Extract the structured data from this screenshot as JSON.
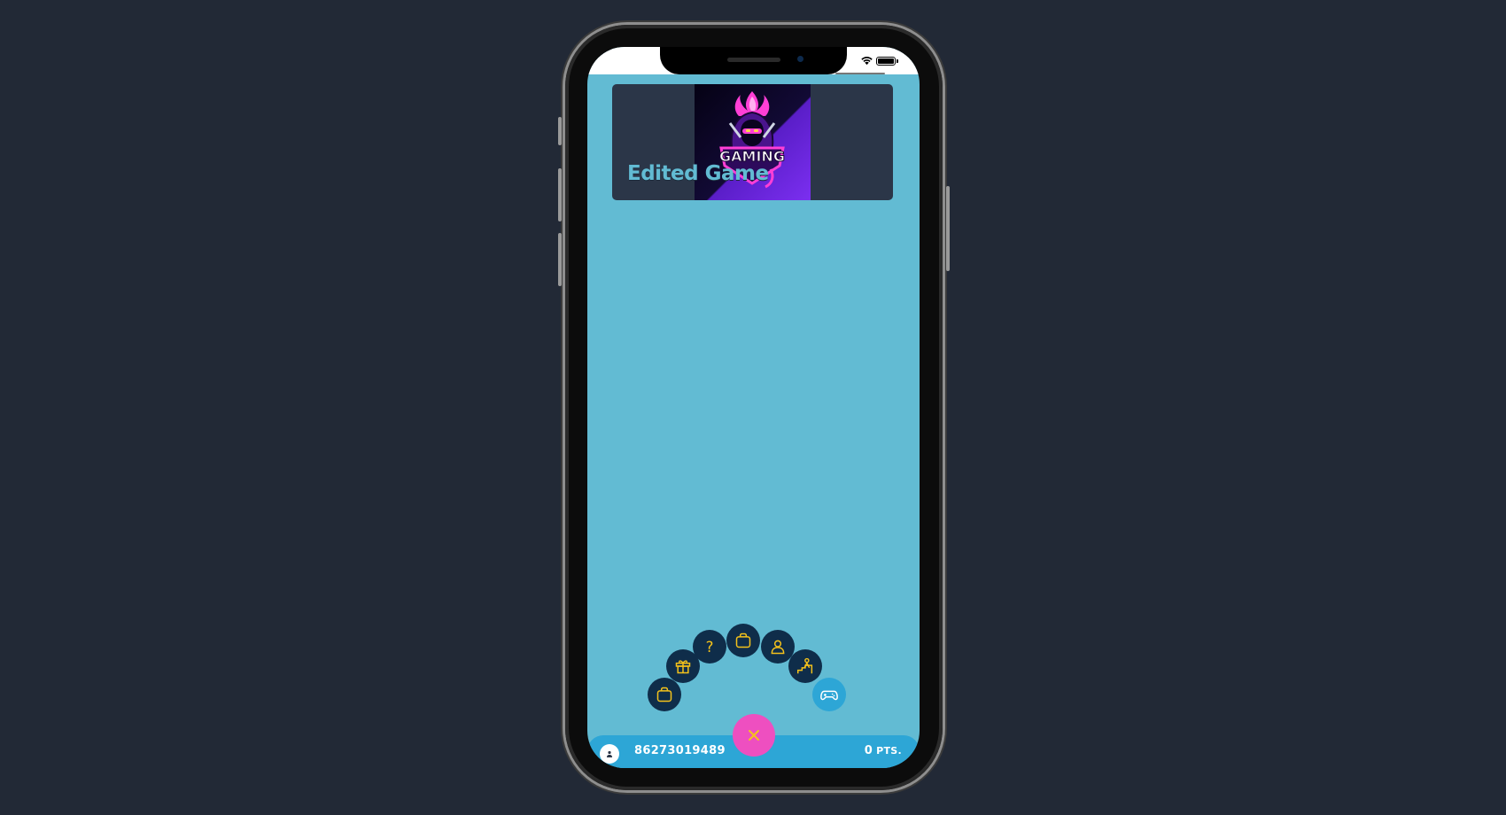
{
  "game_card": {
    "title": "Edited Game",
    "logo": {
      "text": "GAMING",
      "icon": "hooded-ninja-gaming-logo"
    }
  },
  "fab_menu": {
    "items": [
      {
        "name": "bag",
        "icon": "shopping-bag-icon"
      },
      {
        "name": "gift",
        "icon": "gift-icon"
      },
      {
        "name": "help",
        "icon": "question-icon"
      },
      {
        "name": "shop",
        "icon": "shopping-bag-icon"
      },
      {
        "name": "profile",
        "icon": "user-icon"
      },
      {
        "name": "leaderboard",
        "icon": "podium-icon"
      },
      {
        "name": "games",
        "icon": "gamepad-icon"
      }
    ],
    "close_label": "×",
    "icon_color": "#f4c21b",
    "button_color": "#0f2d4a",
    "close_color": "#ee4fc0"
  },
  "bottom_bar": {
    "phone": "86273019489",
    "points_value": "0",
    "points_unit": "PTS."
  },
  "colors": {
    "background": "#222936",
    "screen": "#62bbd3",
    "bar": "#2da6d6",
    "card": "#2b3648"
  }
}
